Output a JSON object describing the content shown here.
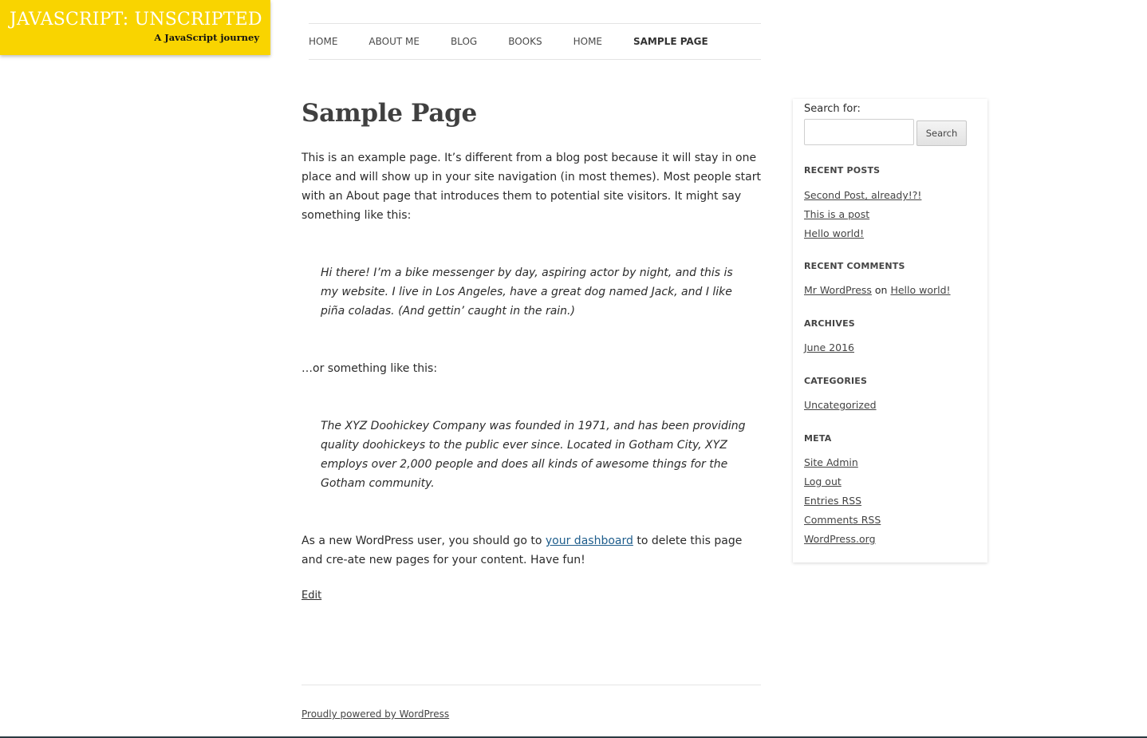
{
  "site": {
    "title": "JAVASCRIPT: UNSCRIPTED",
    "description": "A JavaScript journey"
  },
  "nav": {
    "items": [
      {
        "label": "HOME",
        "current": false
      },
      {
        "label": "ABOUT ME",
        "current": false
      },
      {
        "label": "BLOG",
        "current": false
      },
      {
        "label": "BOOKS",
        "current": false
      },
      {
        "label": "HOME",
        "current": false
      },
      {
        "label": "SAMPLE PAGE",
        "current": true
      }
    ]
  },
  "page": {
    "title": "Sample Page",
    "intro": "This is an example page. It’s different from a blog post because it will stay in one place and will show up in your site navigation (in most themes). Most people start with an About page that introduces them to potential site visitors. It might say something like this:",
    "quote1": "Hi there! I’m a bike messenger by day, aspiring actor by night, and this is my website. I live in Los Angeles, have a great dog named Jack, and I like piña coladas. (And gettin’ caught in the rain.)",
    "middle": "…or something like this:",
    "quote2": "The XYZ Doohickey Company was founded in 1971, and has been providing quality doohickeys to the public ever since. Located in Gotham City, XYZ employs over 2,000 people and does all kinds of awesome things for the Gotham community.",
    "outro_before": "As a new WordPress user, you should go to ",
    "outro_link": "your dashboard",
    "outro_after": " to delete this page and cre-ate new pages for your content. Have fun!",
    "edit_label": "Edit"
  },
  "sidebar": {
    "search_label": "Search for:",
    "search_value": "",
    "search_button": "Search",
    "recent_posts": {
      "title": "RECENT POSTS",
      "items": [
        "Second Post, already!?!",
        "This is a post",
        "Hello world!"
      ]
    },
    "recent_comments": {
      "title": "RECENT COMMENTS",
      "author": "Mr WordPress",
      "on": " on ",
      "post": "Hello world!"
    },
    "archives": {
      "title": "ARCHIVES",
      "items": [
        "June 2016"
      ]
    },
    "categories": {
      "title": "CATEGORIES",
      "items": [
        "Uncategorized"
      ]
    },
    "meta": {
      "title": "META",
      "items": [
        "Site Admin",
        "Log out",
        "Entries RSS",
        "Comments RSS",
        "WordPress.org"
      ]
    }
  },
  "footer": {
    "powered": "Proudly powered by WordPress"
  },
  "colors": {
    "badge": "#f9d400",
    "link": "#1e5d8c",
    "footer_bar": "#2b3a42"
  }
}
